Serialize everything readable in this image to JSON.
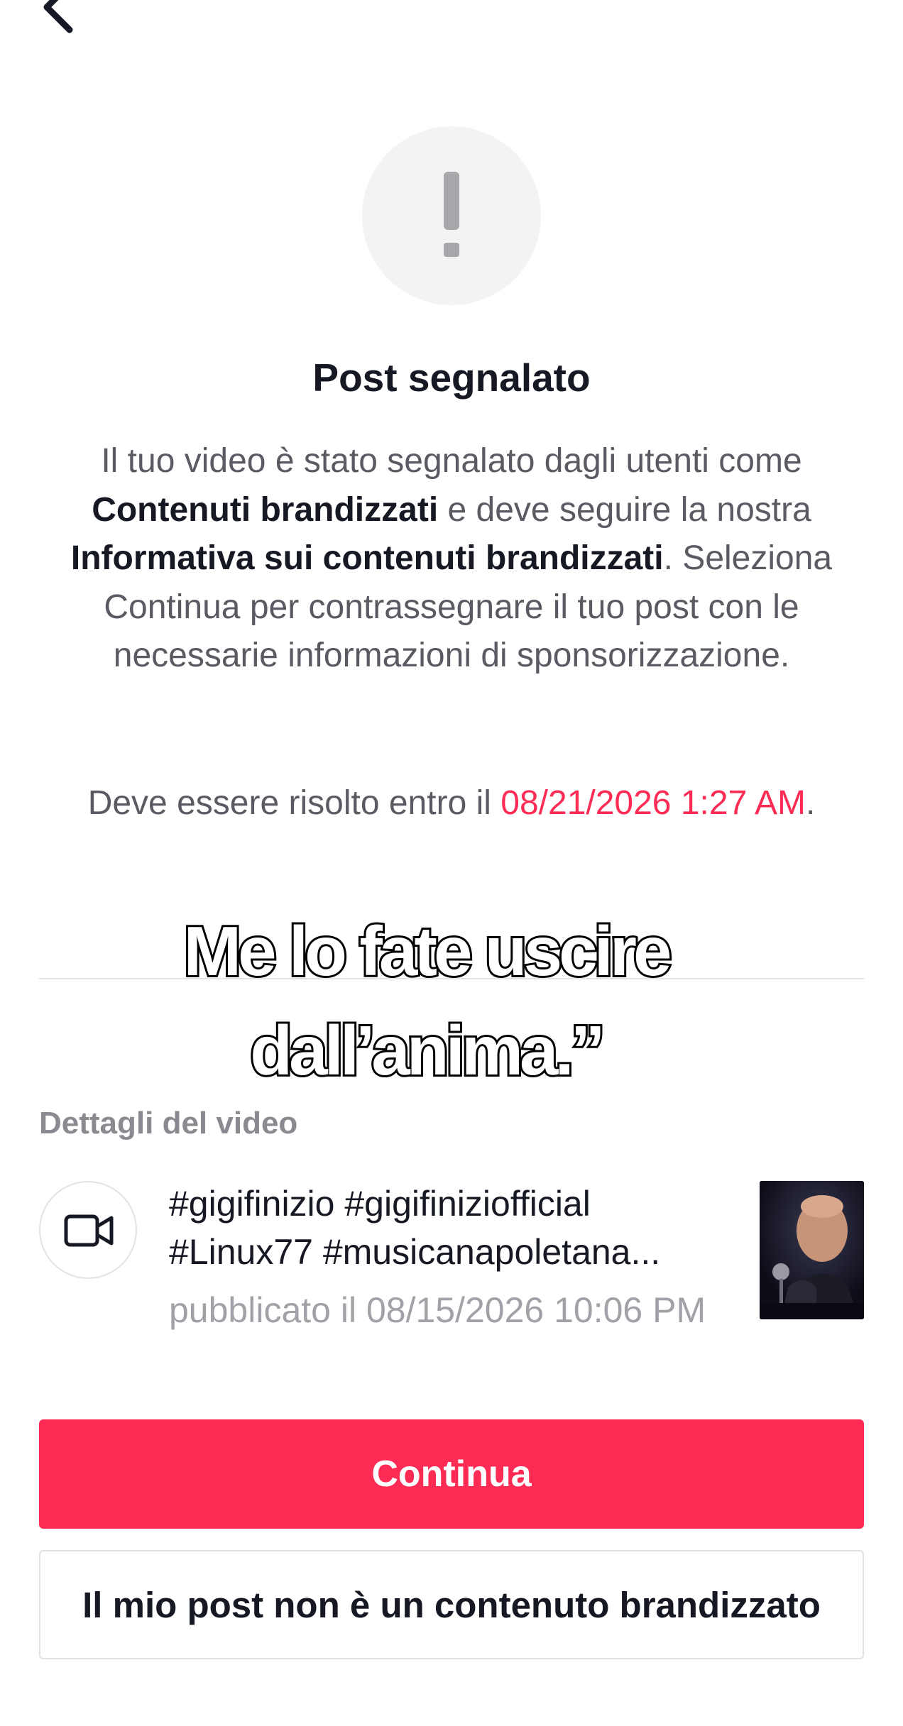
{
  "header": {
    "back_icon": "back-arrow-icon"
  },
  "alert": {
    "icon": "exclamation-icon"
  },
  "title": "Post segnalato",
  "description": {
    "part1": "Il tuo video è stato segnalato dagli utenti come ",
    "bold1": "Contenuti brandizzati",
    "part2": " e deve seguire la nostra ",
    "bold2": "Informativa sui contenuti brandizzati",
    "part3": ". Seleziona Continua per contrassegnare il tuo post con le necessarie informazioni di sponsorizzazione."
  },
  "deadline": {
    "prefix": "Deve essere risolto entro il ",
    "date": "08/21/2026 1:27 AM",
    "suffix": "."
  },
  "overlay_caption": "Me lo fate uscire dall’anima.”",
  "video_details": {
    "section_label": "Dettagli del video",
    "icon": "video-camera-icon",
    "caption": "#gigifinizio #gigifiniziofficial #Linux77 #musicanapoletana...",
    "published": "pubblicato il 08/15/2026 10:06 PM"
  },
  "buttons": {
    "continue_label": "Continua",
    "not_branded_label": "Il mio post non è un contenuto brandizzato"
  },
  "colors": {
    "accent": "#fe2c55",
    "text_primary": "#161823",
    "text_secondary": "#5a5b62",
    "text_muted": "#a1a2a7",
    "divider": "#e3e3e4"
  }
}
